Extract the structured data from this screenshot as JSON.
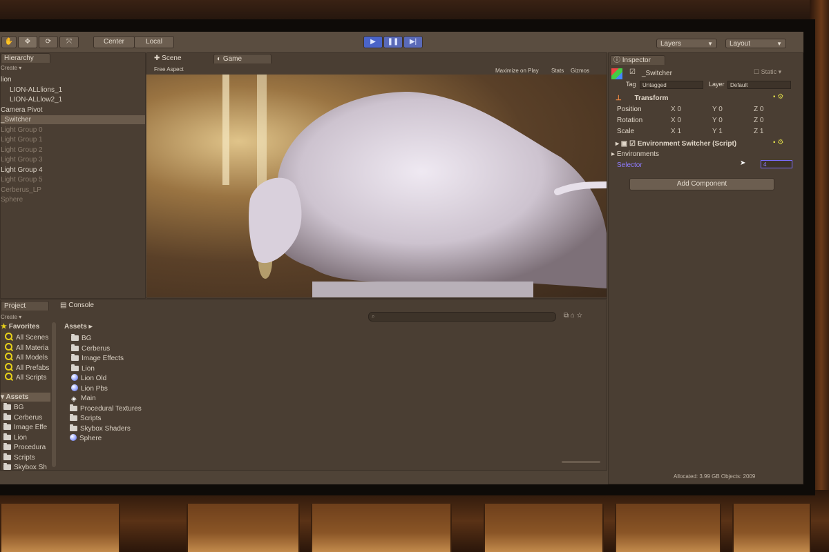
{
  "toolbar": {
    "pivot_label": "Center",
    "space_label": "Local",
    "layers_label": "Layers",
    "layout_label": "Layout"
  },
  "hierarchy": {
    "tab_label": "Hierarchy",
    "create_label": "Create ▾",
    "items": [
      {
        "label": "lion",
        "dim": false
      },
      {
        "label": "LION-ALLlions_1",
        "dim": false
      },
      {
        "label": "LION-ALLlow2_1",
        "dim": false
      },
      {
        "label": "Camera Pivot",
        "dim": false
      },
      {
        "label": "_Switcher",
        "dim": false,
        "selected": true
      },
      {
        "label": "Light Group 0",
        "dim": true
      },
      {
        "label": "Light Group 1",
        "dim": true
      },
      {
        "label": "Light Group 2",
        "dim": true
      },
      {
        "label": "Light Group 3",
        "dim": true
      },
      {
        "label": "Light Group 4",
        "dim": false
      },
      {
        "label": "Light Group 5",
        "dim": true
      },
      {
        "label": "Cerberus_LP",
        "dim": true
      },
      {
        "label": "Sphere",
        "dim": true
      }
    ]
  },
  "view": {
    "scene_tab": "Scene",
    "game_tab": "Game",
    "aspect": "Free Aspect",
    "maximize": "Maximize on Play",
    "stats": "Stats",
    "gizmos": "Gizmos"
  },
  "inspector": {
    "tab_label": "Inspector",
    "object_name": "_Switcher",
    "static_label": "Static",
    "tag_label": "Tag",
    "tag_value": "Untagged",
    "layer_label": "Layer",
    "layer_value": "Default",
    "transform": {
      "title": "Transform",
      "position_label": "Position",
      "rotation_label": "Rotation",
      "scale_label": "Scale",
      "position": {
        "x": "0",
        "y": "0",
        "z": "0"
      },
      "rotation": {
        "x": "0",
        "y": "0",
        "z": "0"
      },
      "scale": {
        "x": "1",
        "y": "1",
        "z": "1"
      }
    },
    "script": {
      "title": "Environment Switcher (Script)",
      "environments_label": "Environments",
      "selector_label": "Selector",
      "selector_value": "4"
    },
    "add_component": "Add Component"
  },
  "project": {
    "project_tab": "Project",
    "console_tab": "Console",
    "create_label": "Create ▾",
    "favorites_label": "Favorites",
    "favorites": [
      "All Scenes",
      "All Materia",
      "All Models",
      "All Prefabs",
      "All Scripts"
    ],
    "assets_label": "Assets",
    "tree_items": [
      "BG",
      "Cerberus",
      "Image Effe",
      "Lion",
      "Procedura",
      "Scripts",
      "Skybox Sh"
    ],
    "breadcrumb": "Assets ▸",
    "assets": [
      {
        "label": "BG",
        "kind": "folder"
      },
      {
        "label": "Cerberus",
        "kind": "folder"
      },
      {
        "label": "Image Effects",
        "kind": "folder"
      },
      {
        "label": "Lion",
        "kind": "folder"
      },
      {
        "label": "Lion Old",
        "kind": "material"
      },
      {
        "label": "Lion Pbs",
        "kind": "material"
      },
      {
        "label": "Main",
        "kind": "scene"
      },
      {
        "label": "Procedural Textures",
        "kind": "folder"
      },
      {
        "label": "Scripts",
        "kind": "folder"
      },
      {
        "label": "Skybox Shaders",
        "kind": "folder"
      },
      {
        "label": "Sphere",
        "kind": "material"
      }
    ]
  },
  "status": {
    "text": "Allocated: 3.99 GB Objects: 2009"
  },
  "colors": {
    "play_active": "#4a64c8",
    "selector_text": "#8f7cff",
    "favorite_icon": "#e8d21a"
  }
}
